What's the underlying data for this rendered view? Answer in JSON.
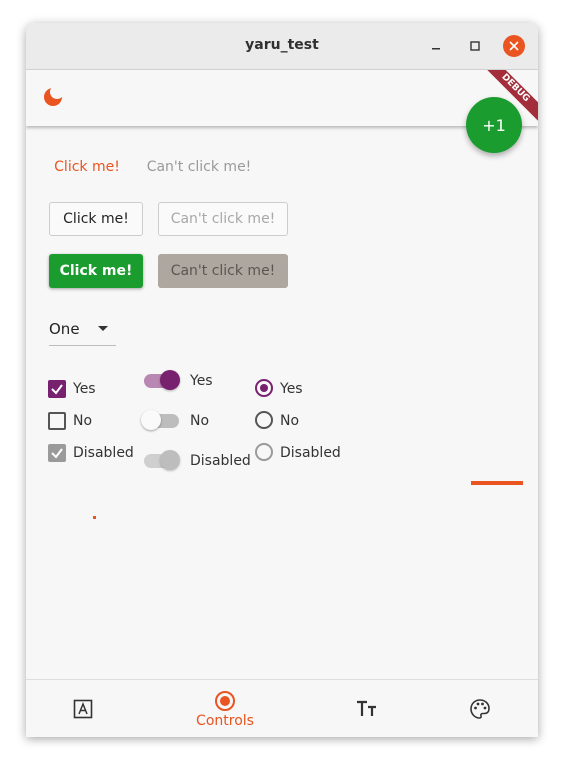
{
  "window": {
    "title": "yaru_test"
  },
  "debug_banner": "DEBUG",
  "fab": {
    "label": "+1"
  },
  "buttons": {
    "text_enabled": "Click me!",
    "text_disabled": "Can't click me!",
    "outlined_enabled": "Click me!",
    "outlined_disabled": "Can't click me!",
    "elevated_enabled": "Click me!",
    "elevated_disabled": "Can't click me!"
  },
  "dropdown": {
    "value": "One"
  },
  "checkboxes": [
    {
      "label": "Yes",
      "checked": true,
      "enabled": true
    },
    {
      "label": "No",
      "checked": false,
      "enabled": true
    },
    {
      "label": "Disabled",
      "checked": true,
      "enabled": false
    }
  ],
  "switches": [
    {
      "label": "Yes",
      "on": true,
      "enabled": true
    },
    {
      "label": "No",
      "on": false,
      "enabled": true
    },
    {
      "label": "Disabled",
      "on": true,
      "enabled": false
    }
  ],
  "radios": [
    {
      "label": "Yes",
      "selected": true,
      "enabled": true
    },
    {
      "label": "No",
      "selected": false,
      "enabled": true
    },
    {
      "label": "Disabled",
      "selected": false,
      "enabled": false
    }
  ],
  "bottom_nav": {
    "items": [
      {
        "icon": "text-box-icon",
        "label": "",
        "active": false
      },
      {
        "icon": "radio-button-icon",
        "label": "Controls",
        "active": true
      },
      {
        "icon": "text-size-icon",
        "label": "",
        "active": false
      },
      {
        "icon": "palette-icon",
        "label": "",
        "active": false
      }
    ]
  },
  "colors": {
    "accent": "#e95420",
    "success": "#1a9c2e",
    "purple": "#77216f",
    "disabled_bg": "#aea79f",
    "debug_ribbon": "#a32d3a"
  }
}
